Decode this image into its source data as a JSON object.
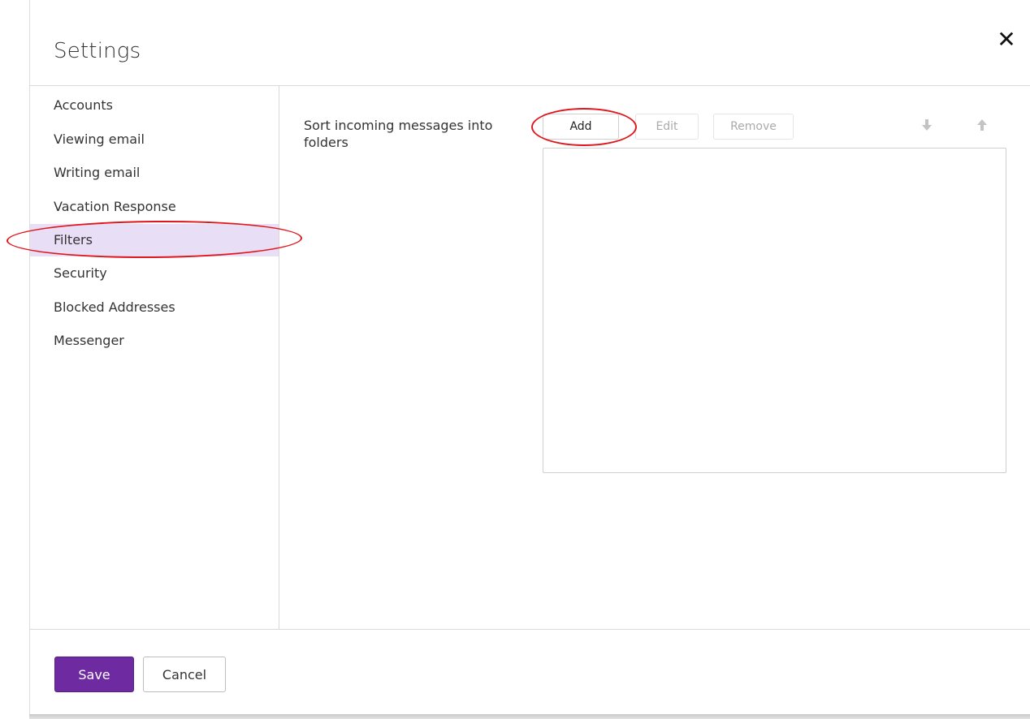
{
  "dialog": {
    "title": "Settings",
    "close_glyph": "✕"
  },
  "sidebar": {
    "items": [
      {
        "label": "Accounts"
      },
      {
        "label": "Viewing email"
      },
      {
        "label": "Writing email"
      },
      {
        "label": "Vacation Response"
      },
      {
        "label": "Filters",
        "selected": true
      },
      {
        "label": "Security"
      },
      {
        "label": "Blocked Addresses"
      },
      {
        "label": "Messenger"
      }
    ]
  },
  "filters": {
    "description": "Sort incoming messages into folders",
    "add_label": "Add",
    "edit_label": "Edit",
    "remove_label": "Remove",
    "move_down_glyph": "🡇",
    "move_up_glyph": "🡅"
  },
  "footer": {
    "save_label": "Save",
    "cancel_label": "Cancel"
  },
  "colors": {
    "accent": "#6e2aa0",
    "selected_bg": "#e8def5",
    "annotation": "#e0161d"
  }
}
